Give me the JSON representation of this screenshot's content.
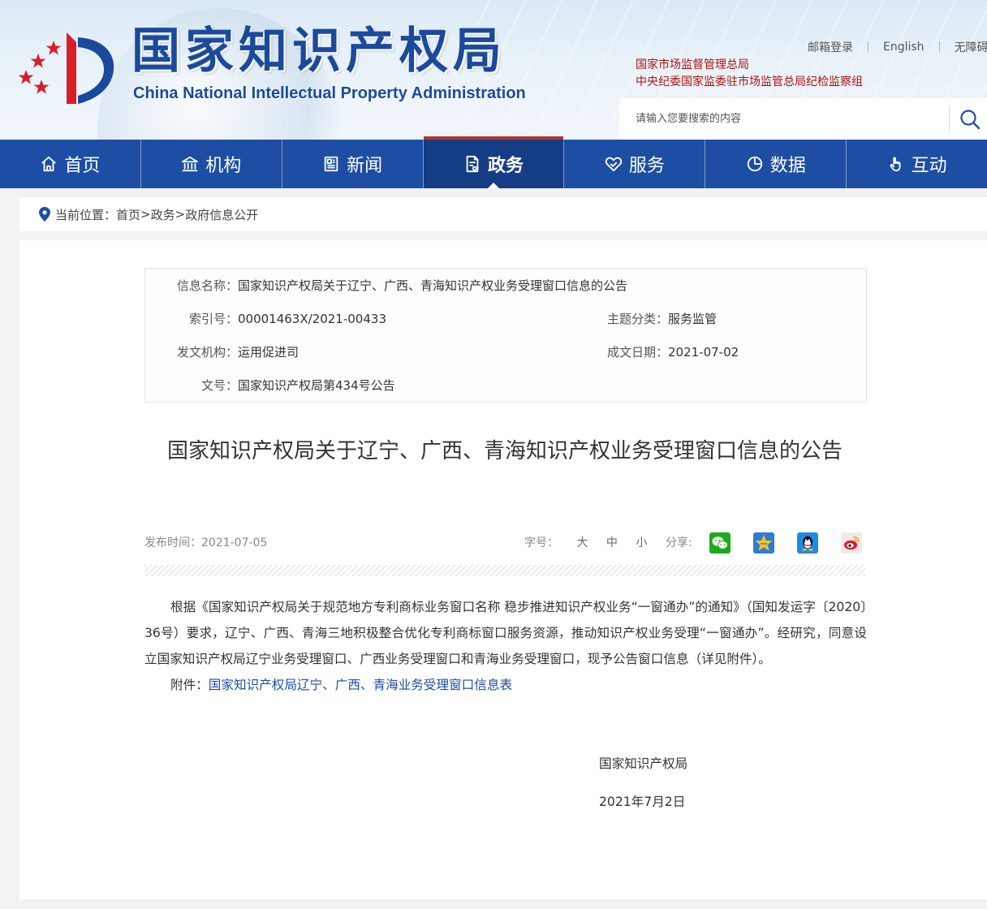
{
  "header": {
    "site_title": "国家知识产权局",
    "site_subtitle": "China National Intellectual Property Administration",
    "top_links": [
      "邮箱登录",
      "English",
      "无障碍"
    ],
    "agency_links": [
      "国家市场监督管理总局",
      "中央纪委国家监委驻市场监管总局纪检监察组"
    ],
    "search_placeholder": "请输入您要搜索的内容"
  },
  "nav": {
    "items": [
      {
        "label": "首页",
        "icon": "home-icon"
      },
      {
        "label": "机构",
        "icon": "institution-icon"
      },
      {
        "label": "新闻",
        "icon": "news-icon"
      },
      {
        "label": "政务",
        "icon": "government-affairs-icon",
        "active": true
      },
      {
        "label": "服务",
        "icon": "service-icon"
      },
      {
        "label": "数据",
        "icon": "data-icon"
      },
      {
        "label": "互动",
        "icon": "interaction-icon"
      }
    ]
  },
  "breadcrumb": {
    "prefix": "当前位置：",
    "items": [
      "首页",
      "政务",
      "政府信息公开"
    ],
    "separator": ">"
  },
  "meta": {
    "name_label": "信息名称：",
    "name_value": "国家知识产权局关于辽宁、广西、青海知识产权业务受理窗口信息的公告",
    "index_label": "索引号：",
    "index_value": "00001463X/2021-00433",
    "topic_label": "主题分类：",
    "topic_value": "服务监管",
    "issuer_label": "发文机构：",
    "issuer_value": "运用促进司",
    "date_label": "成文日期：",
    "date_value": "2021-07-02",
    "docno_label": "文号：",
    "docno_value": "国家知识产权局第434号公告"
  },
  "article": {
    "title": "国家知识产权局关于辽宁、广西、青海知识产权业务受理窗口信息的公告",
    "publish_date": "发布时间：2021-07-05",
    "font_size_label": "字号：",
    "font_sizes": [
      "大",
      "中",
      "小"
    ],
    "share_label": "分享:",
    "share_icons": [
      "wechat-icon",
      "qzone-icon",
      "qq-icon",
      "weibo-icon"
    ],
    "body": "根据《国家知识产权局关于规范地方专利商标业务窗口名称 稳步推进知识产权业务“一窗通办”的通知》（国知发运字〔2020〕36号）要求，辽宁、广西、青海三地积极整合优化专利商标窗口服务资源，推动知识产权业务受理“一窗通办”。经研究，同意设立国家知识产权局辽宁业务受理窗口、广西业务受理窗口和青海业务受理窗口，现予公告窗口信息（详见附件）。",
    "attachment_label": "附件：",
    "attachment_link": "国家知识产权局辽宁、广西、青海业务受理窗口信息表",
    "signature_org": "国家知识产权局",
    "signature_date": "2021年7月2日"
  },
  "colors": {
    "brand_blue": "#1d4ea3",
    "nav_active": "#153d86",
    "agency_red": "#b01010",
    "link_blue": "#1d4ea3"
  }
}
